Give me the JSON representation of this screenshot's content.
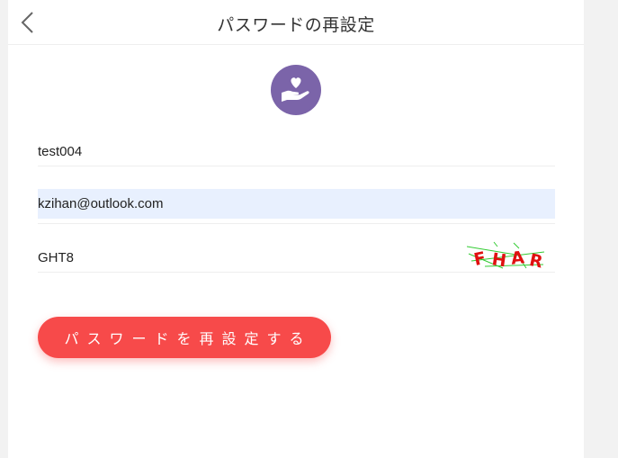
{
  "header": {
    "title": "パスワードの再設定"
  },
  "form": {
    "username": {
      "value": "test004",
      "placeholder": ""
    },
    "email": {
      "value": "kzihan@outlook.com",
      "placeholder": ""
    },
    "captcha": {
      "value": "GHT8",
      "placeholder": "",
      "image_text": "FHAR"
    },
    "submit_label": "パスワードを再設定する"
  },
  "colors": {
    "accent": "#f74a4a",
    "logo": "#7b64a9",
    "autofill": "#e8f0fe"
  },
  "icons": {
    "back": "chevron-left-icon",
    "logo": "heart-hand-icon"
  }
}
